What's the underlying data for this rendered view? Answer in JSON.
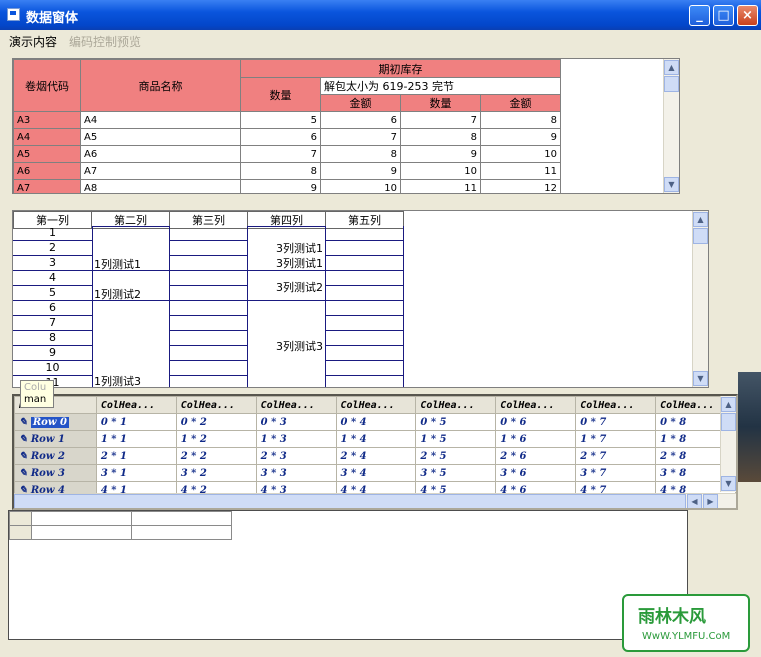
{
  "window": {
    "title": "数据窗体",
    "min": "_",
    "max": "□",
    "close": "×"
  },
  "menu": {
    "demo": "演示内容",
    "preview": "编码控制预览"
  },
  "grid1": {
    "headers": {
      "code": "卷烟代码",
      "name": "商品名称",
      "initial": "期初库存",
      "qty": "数量",
      "amount": "金额",
      "qty2": "数量",
      "amount2": "金额",
      "overlay": "解包太小为 619-253 完节"
    },
    "rows": [
      {
        "code": "A3",
        "name": "A4",
        "c1": "5",
        "c2": "6",
        "c3": "7",
        "c4": "8"
      },
      {
        "code": "A4",
        "name": "A5",
        "c1": "6",
        "c2": "7",
        "c3": "8",
        "c4": "9"
      },
      {
        "code": "A5",
        "name": "A6",
        "c1": "7",
        "c2": "8",
        "c3": "9",
        "c4": "10"
      },
      {
        "code": "A6",
        "name": "A7",
        "c1": "8",
        "c2": "9",
        "c3": "10",
        "c4": "11"
      },
      {
        "code": "A7",
        "name": "A8",
        "c1": "9",
        "c2": "10",
        "c3": "11",
        "c4": "12"
      }
    ]
  },
  "grid2": {
    "headers": [
      "第一列",
      "第二列",
      "第三列",
      "第四列",
      "第五列"
    ],
    "rownums": [
      "1",
      "2",
      "3",
      "4",
      "5",
      "6",
      "7",
      "8",
      "9",
      "10",
      "11"
    ],
    "merge": {
      "a": "1列测试1",
      "b": "1列测试2",
      "c": "1列测试3",
      "d": "3列测试1",
      "e": "3列测试1",
      "f": "3列测试2",
      "g": "3列测试3"
    },
    "tooltip": {
      "line1": "Colu",
      "line2": "man"
    }
  },
  "grid3": {
    "corner": "Hea...",
    "colhdr": "ColHea...",
    "rows": [
      {
        "hdr": "Row 0",
        "cells": [
          "0 * 1",
          "0 * 2",
          "0 * 3",
          "0 * 4",
          "0 * 5",
          "0 * 6",
          "0 * 7",
          "0 * 8"
        ]
      },
      {
        "hdr": "Row 1",
        "cells": [
          "1 * 1",
          "1 * 2",
          "1 * 3",
          "1 * 4",
          "1 * 5",
          "1 * 6",
          "1 * 7",
          "1 * 8"
        ]
      },
      {
        "hdr": "Row 2",
        "cells": [
          "2 * 1",
          "2 * 2",
          "2 * 3",
          "2 * 4",
          "2 * 5",
          "2 * 6",
          "2 * 7",
          "2 * 8"
        ]
      },
      {
        "hdr": "Row 3",
        "cells": [
          "3 * 1",
          "3 * 2",
          "3 * 3",
          "3 * 4",
          "3 * 5",
          "3 * 6",
          "3 * 7",
          "3 * 8"
        ]
      },
      {
        "hdr": "Row 4",
        "cells": [
          "4 * 1",
          "4 * 2",
          "4 * 3",
          "4 * 4",
          "4 * 5",
          "4 * 6",
          "4 * 7",
          "4 * 8"
        ]
      }
    ]
  },
  "watermark": {
    "brand": "雨林木风",
    "url": "WwW.YLMFU.CoM"
  },
  "colors": {
    "titlebar": "#0a55dd",
    "header_pink": "#f08080",
    "grid_text": "#102a88",
    "face": "#ece9d8"
  }
}
